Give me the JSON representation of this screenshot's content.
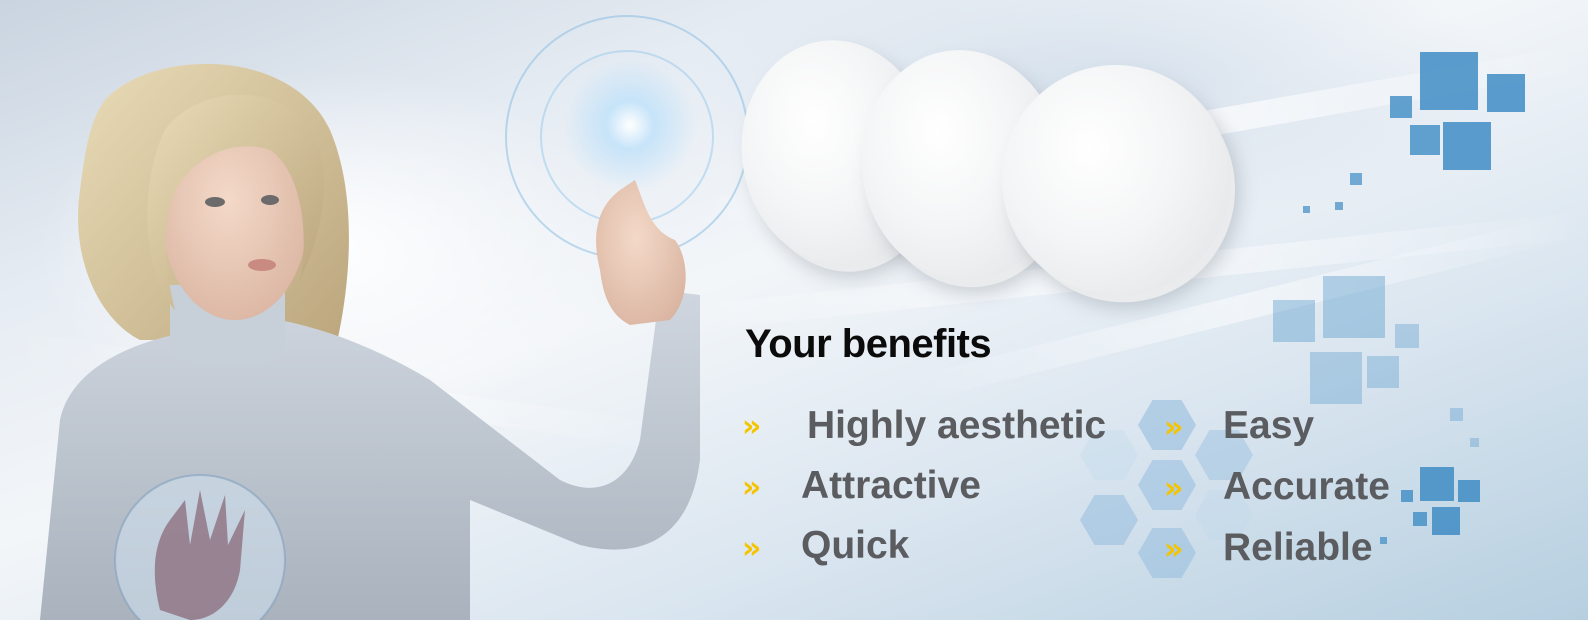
{
  "heading": "Your benefits",
  "bullet_glyph": "»",
  "benefits_left": [
    "Highly aesthetic",
    "Attractive",
    "Quick"
  ],
  "benefits_right": [
    "Easy",
    "Accurate",
    "Reliable"
  ],
  "colors": {
    "heading": "#0b0b0b",
    "benefit_text": "#5a5c60",
    "bullet": "#f5c400",
    "accent_squares": "#3f8cc4",
    "hexagons": "#8fb9dd"
  }
}
